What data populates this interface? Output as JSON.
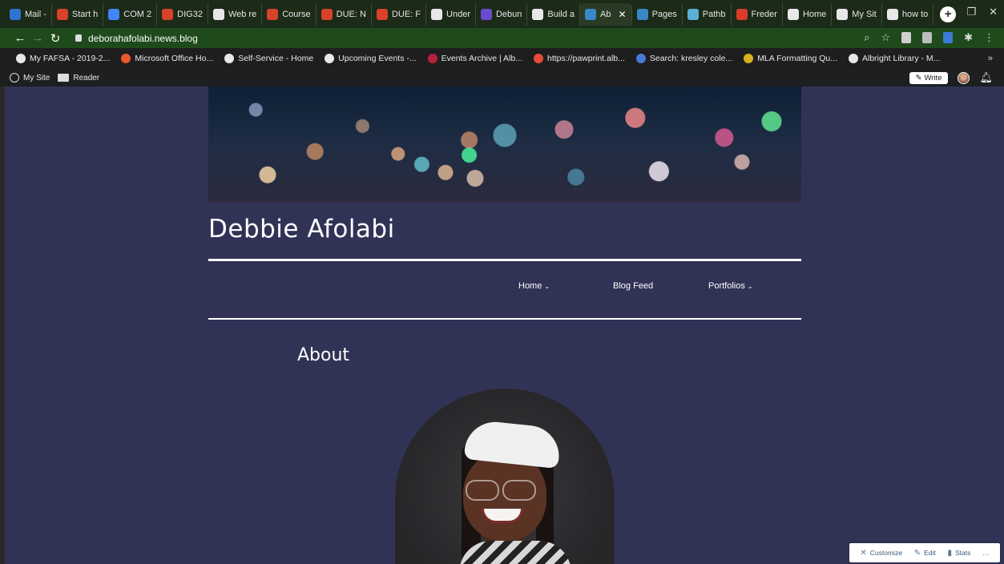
{
  "browser": {
    "tabs": [
      {
        "label": "Mail -",
        "color": "#2f74d0"
      },
      {
        "label": "Start h",
        "color": "#d8412a"
      },
      {
        "label": "COM 2",
        "color": "#4285f4"
      },
      {
        "label": "DIG32",
        "color": "#d8412a"
      },
      {
        "label": "Web re",
        "color": "#e8e8e8"
      },
      {
        "label": "Course",
        "color": "#d8412a"
      },
      {
        "label": "DUE: N",
        "color": "#d8412a"
      },
      {
        "label": "DUE: F",
        "color": "#d8412a"
      },
      {
        "label": "Under",
        "color": "#e8e8e8"
      },
      {
        "label": "Debun",
        "color": "#6a4cd0"
      },
      {
        "label": "Build a",
        "color": "#e8e8e8"
      },
      {
        "label": "Ab",
        "color": "#3a87c8",
        "active": true
      },
      {
        "label": "Pages",
        "color": "#3a87c8"
      },
      {
        "label": "Pathb",
        "color": "#5cb0d8"
      },
      {
        "label": "Freder",
        "color": "#d83c2a"
      },
      {
        "label": "Home",
        "color": "#e8e8e8"
      },
      {
        "label": "My Sit",
        "color": "#e8e8e8"
      },
      {
        "label": "how to",
        "color": "#e8e8e8"
      }
    ],
    "url": "deborahafolabi.news.blog",
    "bookmarks": [
      {
        "label": "My FAFSA - 2019-2...",
        "color": "#e8e8e8"
      },
      {
        "label": "Microsoft Office Ho...",
        "color": "#e8592a"
      },
      {
        "label": "Self-Service - Home",
        "color": "#e8e8e8"
      },
      {
        "label": "Upcoming Events -...",
        "color": "#e8e8e8"
      },
      {
        "label": "Events Archive | Alb...",
        "color": "#b8203a"
      },
      {
        "label": "https://pawprint.alb...",
        "color": "#e84a3a"
      },
      {
        "label": "Search: kresley cole...",
        "color": "#4a7ad8"
      },
      {
        "label": "MLA Formatting Qu...",
        "color": "#d8b020"
      },
      {
        "label": "Albright Library - M...",
        "color": "#e8e8e8"
      }
    ],
    "bookmarks_more": "»"
  },
  "wp_admin": {
    "my_site": "My Site",
    "reader": "Reader",
    "write": "Write"
  },
  "site": {
    "title": "Debbie Afolabi",
    "nav": [
      {
        "label": "Home",
        "dropdown": true
      },
      {
        "label": "Blog Feed",
        "dropdown": false
      },
      {
        "label": "Portfolios",
        "dropdown": true
      }
    ],
    "page_title": "About"
  },
  "action_bar": {
    "customize": "Customize",
    "edit": "Edit",
    "stats": "Stats",
    "more": "…"
  }
}
